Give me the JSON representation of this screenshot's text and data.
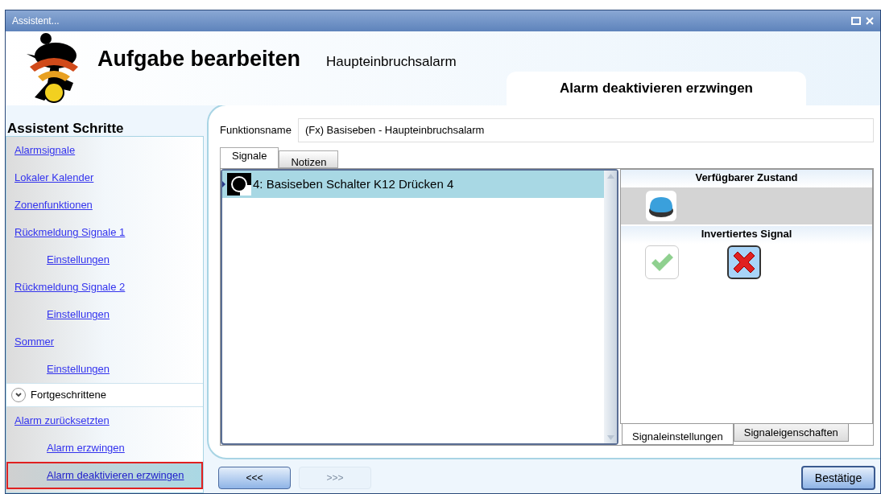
{
  "window": {
    "title": "Assistent..."
  },
  "header": {
    "title": "Aufgabe bearbeiten",
    "subtitle": "Haupteinbruchsalarm"
  },
  "page_tab": "Alarm deaktivieren erzwingen",
  "sidebar": {
    "title": "Assistent Schritte",
    "items": [
      {
        "label": "Alarmsignale",
        "selected": false
      },
      {
        "label": "Lokaler Kalender",
        "selected": false
      },
      {
        "label": "Zonenfunktionen",
        "selected": false
      },
      {
        "label": "Rückmeldung Signale 1",
        "selected": false,
        "children": [
          {
            "label": "Einstellungen",
            "selected": false
          }
        ]
      },
      {
        "label": "Rückmeldung Signale 2",
        "selected": false,
        "children": [
          {
            "label": "Einstellungen",
            "selected": false
          }
        ]
      },
      {
        "label": "Sommer",
        "selected": false,
        "children": [
          {
            "label": "Einstellungen",
            "selected": false
          }
        ]
      }
    ],
    "section": {
      "label": "Fortgeschrittene",
      "expanded": true,
      "items": [
        {
          "label": "Alarm zurücksetzten",
          "selected": false,
          "children": [
            {
              "label": "Alarm erzwingen",
              "selected": false
            },
            {
              "label": "Alarm deaktivieren erzwingen",
              "selected": true
            }
          ]
        }
      ]
    }
  },
  "function_name": {
    "label": "Funktionsname",
    "value": "(Fx) Basiseben - Haupteinbruchsalarm"
  },
  "tabs": [
    {
      "label": "Signale",
      "selected": true
    },
    {
      "label": "Notizen",
      "selected": false
    }
  ],
  "signals": [
    {
      "label": "4: Basiseben Schalter K12 Drücken 4",
      "selected": true
    }
  ],
  "state_panel": {
    "available_title": "Verfügbarer Zustand",
    "inverted_title": "Invertiertes Signal",
    "inverted_options": [
      {
        "kind": "check",
        "selected": false
      },
      {
        "kind": "cross",
        "selected": true
      }
    ]
  },
  "bottom_tabs": [
    {
      "label": "Signaleinstellungen",
      "selected": true
    },
    {
      "label": "Signaleigenschaften",
      "selected": false
    }
  ],
  "buttons": [
    {
      "label": "<<<",
      "disabled": false
    },
    {
      "label": ">>>",
      "disabled": true
    }
  ],
  "confirm": {
    "label": "Bestätige",
    "disabled": false
  }
}
